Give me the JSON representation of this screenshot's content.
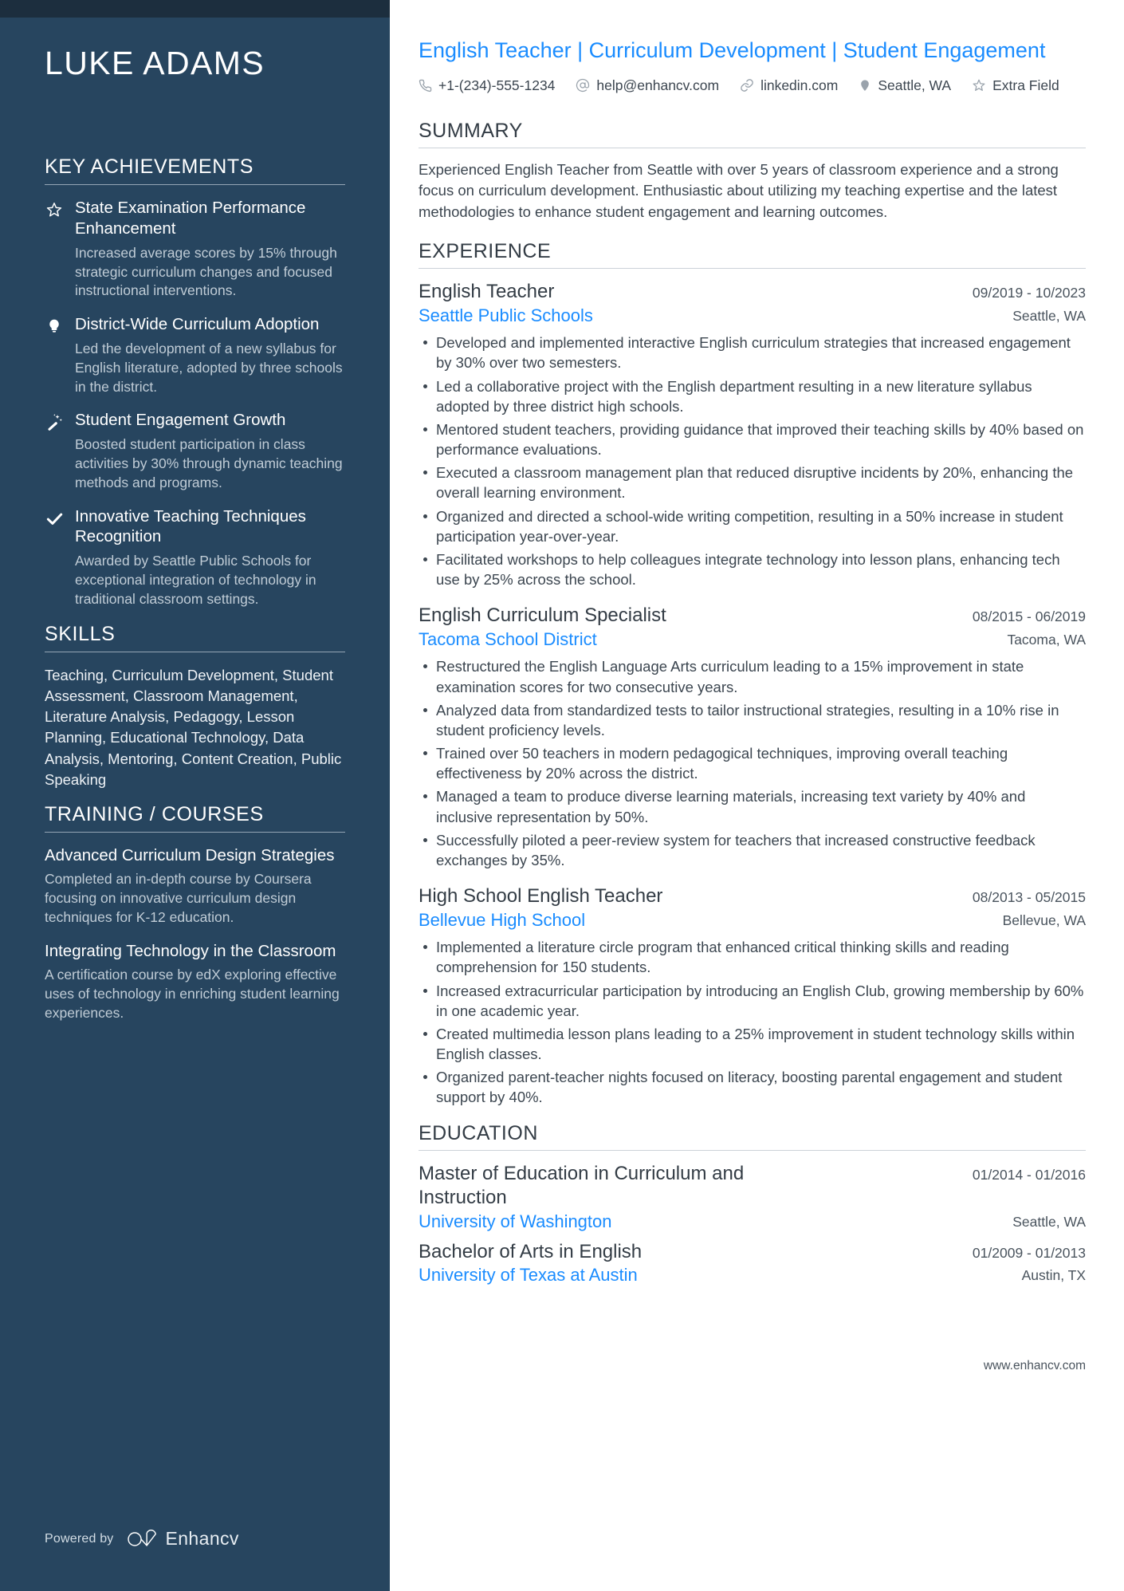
{
  "sidebar": {
    "name": "LUKE ADAMS",
    "achievements_heading": "KEY ACHIEVEMENTS",
    "achievements": [
      {
        "icon": "star-icon",
        "title": "State Examination Performance Enhancement",
        "desc": "Increased average scores by 15% through strategic curriculum changes and focused instructional interventions."
      },
      {
        "icon": "lightbulb-icon",
        "title": "District-Wide Curriculum Adoption",
        "desc": "Led the development of a new syllabus for English literature, adopted by three schools in the district."
      },
      {
        "icon": "magic-wand-icon",
        "title": "Student Engagement Growth",
        "desc": "Boosted student participation in class activities by 30% through dynamic teaching methods and programs."
      },
      {
        "icon": "check-icon",
        "title": "Innovative Teaching Techniques Recognition",
        "desc": "Awarded by Seattle Public Schools for exceptional integration of technology in traditional classroom settings."
      }
    ],
    "skills_heading": "SKILLS",
    "skills_text": "Teaching, Curriculum Development, Student Assessment, Classroom Management, Literature Analysis, Pedagogy, Lesson Planning, Educational Technology, Data Analysis, Mentoring, Content Creation, Public Speaking",
    "training_heading": "TRAINING / COURSES",
    "courses": [
      {
        "title": "Advanced Curriculum Design Strategies",
        "desc": "Completed an in-depth course by Coursera focusing on innovative curriculum design techniques for K-12 education."
      },
      {
        "title": "Integrating Technology in the Classroom",
        "desc": "A certification course by edX exploring effective uses of technology in enriching student learning experiences."
      }
    ],
    "footer": {
      "powered_by": "Powered by",
      "brand": "Enhancv"
    }
  },
  "header": {
    "headline": "English Teacher | Curriculum Development | Student Engagement",
    "contacts": [
      {
        "icon": "phone-icon",
        "text": "+1-(234)-555-1234"
      },
      {
        "icon": "at-icon",
        "text": "help@enhancv.com"
      },
      {
        "icon": "link-icon",
        "text": "linkedin.com"
      },
      {
        "icon": "map-pin-icon",
        "text": "Seattle, WA"
      },
      {
        "icon": "star-icon",
        "text": "Extra Field"
      }
    ]
  },
  "summary": {
    "heading": "SUMMARY",
    "text": "Experienced English Teacher from Seattle with over 5 years of classroom experience and a strong focus on curriculum development. Enthusiastic about utilizing my teaching expertise and the latest methodologies to enhance student engagement and learning outcomes."
  },
  "experience": {
    "heading": "EXPERIENCE",
    "jobs": [
      {
        "title": "English Teacher",
        "date": "09/2019 - 10/2023",
        "company": "Seattle Public Schools",
        "location": "Seattle, WA",
        "bullets": [
          "Developed and implemented interactive English curriculum strategies that increased engagement by 30% over two semesters.",
          "Led a collaborative project with the English department resulting in a new literature syllabus adopted by three district high schools.",
          "Mentored student teachers, providing guidance that improved their teaching skills by 40% based on performance evaluations.",
          "Executed a classroom management plan that reduced disruptive incidents by 20%, enhancing the overall learning environment.",
          "Organized and directed a school-wide writing competition, resulting in a 50% increase in student participation year-over-year.",
          "Facilitated workshops to help colleagues integrate technology into lesson plans, enhancing tech use by 25% across the school."
        ]
      },
      {
        "title": "English Curriculum Specialist",
        "date": "08/2015 - 06/2019",
        "company": "Tacoma School District",
        "location": "Tacoma, WA",
        "bullets": [
          "Restructured the English Language Arts curriculum leading to a 15% improvement in state examination scores for two consecutive years.",
          "Analyzed data from standardized tests to tailor instructional strategies, resulting in a 10% rise in student proficiency levels.",
          "Trained over 50 teachers in modern pedagogical techniques, improving overall teaching effectiveness by 20% across the district.",
          "Managed a team to produce diverse learning materials, increasing text variety by 40% and inclusive representation by 50%.",
          "Successfully piloted a peer-review system for teachers that increased constructive feedback exchanges by 35%."
        ]
      },
      {
        "title": "High School English Teacher",
        "date": "08/2013 - 05/2015",
        "company": "Bellevue High School",
        "location": "Bellevue, WA",
        "bullets": [
          "Implemented a literature circle program that enhanced critical thinking skills and reading comprehension for 150 students.",
          "Increased extracurricular participation by introducing an English Club, growing membership by 60% in one academic year.",
          "Created multimedia lesson plans leading to a 25% improvement in student technology skills within English classes.",
          "Organized parent-teacher nights focused on literacy, boosting parental engagement and student support by 40%."
        ]
      }
    ]
  },
  "education": {
    "heading": "EDUCATION",
    "entries": [
      {
        "degree": "Master of Education in Curriculum and Instruction",
        "date": "01/2014 - 01/2016",
        "school": "University of Washington",
        "location": "Seattle, WA"
      },
      {
        "degree": "Bachelor of Arts in English",
        "date": "01/2009 - 01/2013",
        "school": "University of Texas at Austin",
        "location": "Austin, TX"
      }
    ]
  },
  "footer": {
    "website": "www.enhancv.com"
  },
  "colors": {
    "sidebar_bg": "#27455f",
    "sidebar_top": "#1c2e3e",
    "accent_blue": "#1a8cff",
    "body_text": "#3c4650"
  }
}
